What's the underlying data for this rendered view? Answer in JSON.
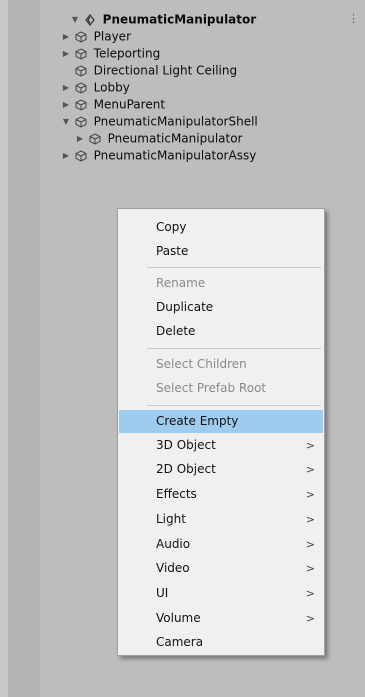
{
  "hierarchy": {
    "scene": "PneumaticManipulator",
    "items": [
      {
        "label": "Player",
        "expandable": true
      },
      {
        "label": "Teleporting",
        "expandable": true
      },
      {
        "label": "Directional Light Ceiling",
        "expandable": false
      },
      {
        "label": "Lobby",
        "expandable": true
      },
      {
        "label": "MenuParent",
        "expandable": true
      },
      {
        "label": "PneumaticManipulatorShell",
        "expandable": true,
        "expanded": true
      },
      {
        "label": "PneumaticManipulator",
        "expandable": true,
        "child": true
      },
      {
        "label": "PneumaticManipulatorAssy",
        "expandable": true
      }
    ]
  },
  "context_menu": {
    "items": [
      {
        "label": "Copy",
        "enabled": true
      },
      {
        "label": "Paste",
        "enabled": true
      },
      {
        "label": "Rename",
        "enabled": false
      },
      {
        "label": "Duplicate",
        "enabled": true
      },
      {
        "label": "Delete",
        "enabled": true
      },
      {
        "label": "Select Children",
        "enabled": false
      },
      {
        "label": "Select Prefab Root",
        "enabled": false
      },
      {
        "label": "Create Empty",
        "enabled": true,
        "highlighted": true
      },
      {
        "label": "3D Object",
        "enabled": true,
        "submenu": true
      },
      {
        "label": "2D Object",
        "enabled": true,
        "submenu": true
      },
      {
        "label": "Effects",
        "enabled": true,
        "submenu": true
      },
      {
        "label": "Light",
        "enabled": true,
        "submenu": true
      },
      {
        "label": "Audio",
        "enabled": true,
        "submenu": true
      },
      {
        "label": "Video",
        "enabled": true,
        "submenu": true
      },
      {
        "label": "UI",
        "enabled": true,
        "submenu": true
      },
      {
        "label": "Volume",
        "enabled": true,
        "submenu": true
      },
      {
        "label": "Camera",
        "enabled": true
      }
    ],
    "submenu_glyph": ">"
  },
  "colors": {
    "highlight": "#9dccef",
    "disabled_text": "#8a8a8a"
  }
}
